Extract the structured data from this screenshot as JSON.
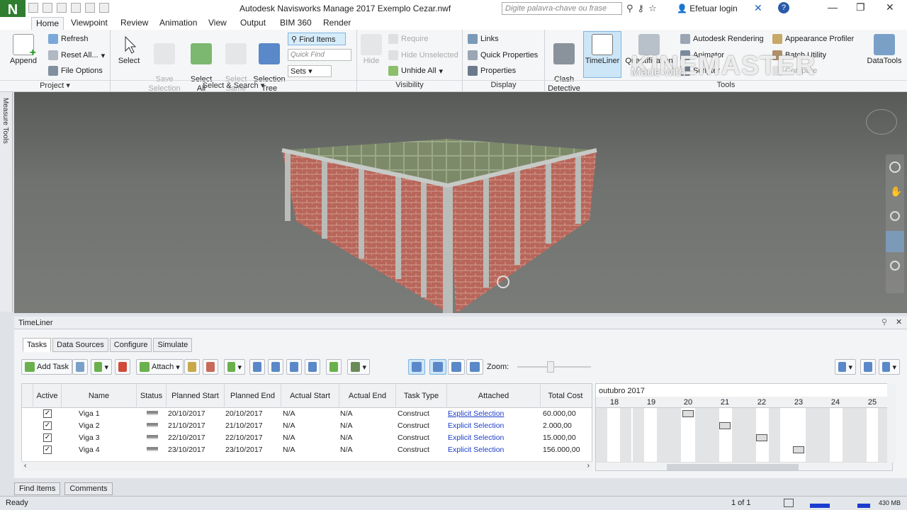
{
  "window": {
    "app_letter": "N",
    "title": "Autodesk Navisworks Manage 2017    Exemplo Cezar.nwf",
    "search_placeholder": "Digite palavra-chave ou frase",
    "login": "Efetuar login",
    "help": "?",
    "minimize": "—",
    "maximize": "❐",
    "close": "✕"
  },
  "ribbon_tabs": [
    "Home",
    "Viewpoint",
    "Review",
    "Animation",
    "View",
    "Output",
    "BIM 360",
    "Render"
  ],
  "ribbon": {
    "project": {
      "append": "Append",
      "refresh": "Refresh",
      "reset_all": "Reset All...",
      "file_options": "File Options",
      "title": "Project ▾"
    },
    "select_search": {
      "select": "Select",
      "save_selection": "Save\nSelection",
      "select_all": "Select\nAll",
      "select_same": "Select\nSame",
      "selection_tree": "Selection\nTree",
      "find_items": "Find Items",
      "quick_find": "Quick Find",
      "sets": "Sets",
      "title": "Select & Search ▾"
    },
    "visibility": {
      "hide": "Hide",
      "require": "Require",
      "hide_unselected": "Hide Unselected",
      "unhide_all": "Unhide All",
      "title": "Visibility"
    },
    "display": {
      "links": "Links",
      "quick_properties": "Quick Properties",
      "properties": "Properties",
      "title": "Display"
    },
    "tools": {
      "clash_detective": "Clash\nDetective",
      "timeliner": "TimeLiner",
      "quantification": "Quantification",
      "autodesk_rendering": "Autodesk Rendering",
      "animator": "Animator",
      "scripter": "Scripter",
      "appearance_profiler": "Appearance Profiler",
      "batch_utility": "Batch Utility",
      "compare": "Compare",
      "datatools": "DataTools",
      "title": "Tools"
    }
  },
  "watermark": {
    "main": "KINEMASTER",
    "sub": "Made with"
  },
  "measure_tools": "Measure Tools",
  "timeliner": {
    "title": "TimeLiner",
    "tabs": [
      "Tasks",
      "Data Sources",
      "Configure",
      "Simulate"
    ],
    "toolbar": {
      "add_task": "Add Task",
      "attach": "Attach",
      "zoom": "Zoom:"
    },
    "columns": [
      "Active",
      "Name",
      "Status",
      "Planned Start",
      "Planned End",
      "Actual Start",
      "Actual End",
      "Task Type",
      "Attached",
      "Total Cost"
    ],
    "rows": [
      {
        "name": "Viga 1",
        "planned_start": "20/10/2017",
        "planned_end": "20/10/2017",
        "actual_start": "N/A",
        "actual_end": "N/A",
        "task_type": "Construct",
        "attached": "Explicit Selection",
        "total_cost": "60.000,00",
        "check": "✓"
      },
      {
        "name": "Viga 2",
        "planned_start": "21/10/2017",
        "planned_end": "21/10/2017",
        "actual_start": "N/A",
        "actual_end": "N/A",
        "task_type": "Construct",
        "attached": "Explicit Selection",
        "total_cost": "2.000,00",
        "check": "✓"
      },
      {
        "name": "Viga 3",
        "planned_start": "22/10/2017",
        "planned_end": "22/10/2017",
        "actual_start": "N/A",
        "actual_end": "N/A",
        "task_type": "Construct",
        "attached": "Explicit Selection",
        "total_cost": "15.000,00",
        "check": "✓"
      },
      {
        "name": "Viga 4",
        "planned_start": "23/10/2017",
        "planned_end": "23/10/2017",
        "actual_start": "N/A",
        "actual_end": "N/A",
        "task_type": "Construct",
        "attached": "Explicit Selection",
        "total_cost": "156.000,00",
        "check": "✓"
      }
    ],
    "gantt": {
      "month": "outubro 2017",
      "days": [
        "18",
        "19",
        "20",
        "21",
        "22",
        "23",
        "24",
        "25"
      ]
    }
  },
  "bottom_tabs": [
    "Find Items",
    "Comments"
  ],
  "status": {
    "ready": "Ready",
    "page": "1 of 1",
    "memory": "430 MB"
  },
  "colors": {
    "accent": "#2f7d2f",
    "link": "#1a3cc8",
    "selected": "#cde6f7"
  }
}
